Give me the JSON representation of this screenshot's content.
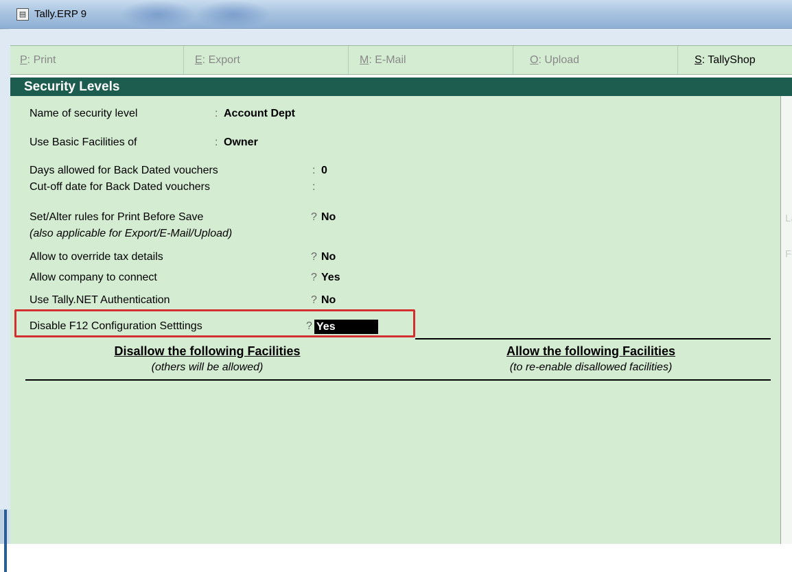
{
  "window": {
    "title": "Tally.ERP 9",
    "icon": "tally-app-icon"
  },
  "buttons": [
    {
      "key": "P",
      "label": ": Print"
    },
    {
      "key": "E",
      "label": ": Export"
    },
    {
      "key": "M",
      "label": ": E-Mail"
    },
    {
      "key": "O",
      "label": ": Upload"
    },
    {
      "key": "S",
      "label": ": TallyShop"
    }
  ],
  "header": {
    "title": "Security Levels"
  },
  "form": {
    "name_label": "Name of security level",
    "name_sep": ":",
    "name_value": "Account Dept",
    "basic_label": "Use Basic Facilities of",
    "basic_sep": ":",
    "basic_value": "Owner",
    "days_label": "Days allowed for Back Dated vouchers",
    "days_sep": ":",
    "days_value": "0",
    "cutoff_label": "Cut-off date for Back Dated vouchers",
    "cutoff_sep": ":",
    "print_label": "Set/Alter rules for Print Before Save",
    "print_sep": "?",
    "print_value": "No",
    "print_note": "(also applicable for Export/E-Mail/Upload)",
    "tax_label": "Allow to override tax details",
    "tax_sep": "?",
    "tax_value": "No",
    "connect_label": "Allow company to connect",
    "connect_sep": "?",
    "connect_value": "Yes",
    "tallynet_label": "Use Tally.NET Authentication",
    "tallynet_sep": "?",
    "tallynet_value": "No",
    "f12_label": "Disable F12 Configuration Setttings",
    "f12_sep": "?",
    "f12_value": "Yes"
  },
  "facilities": {
    "disallow_title": "Disallow the following Facilities",
    "disallow_sub": "(others will be allowed)",
    "allow_title": "Allow the following Facilities",
    "allow_sub": "(to re-enable disallowed facilities)"
  },
  "colors": {
    "header_bg": "#1d5d4f",
    "content_bg": "#d4ecd2",
    "highlight_border": "#d32f2f"
  }
}
